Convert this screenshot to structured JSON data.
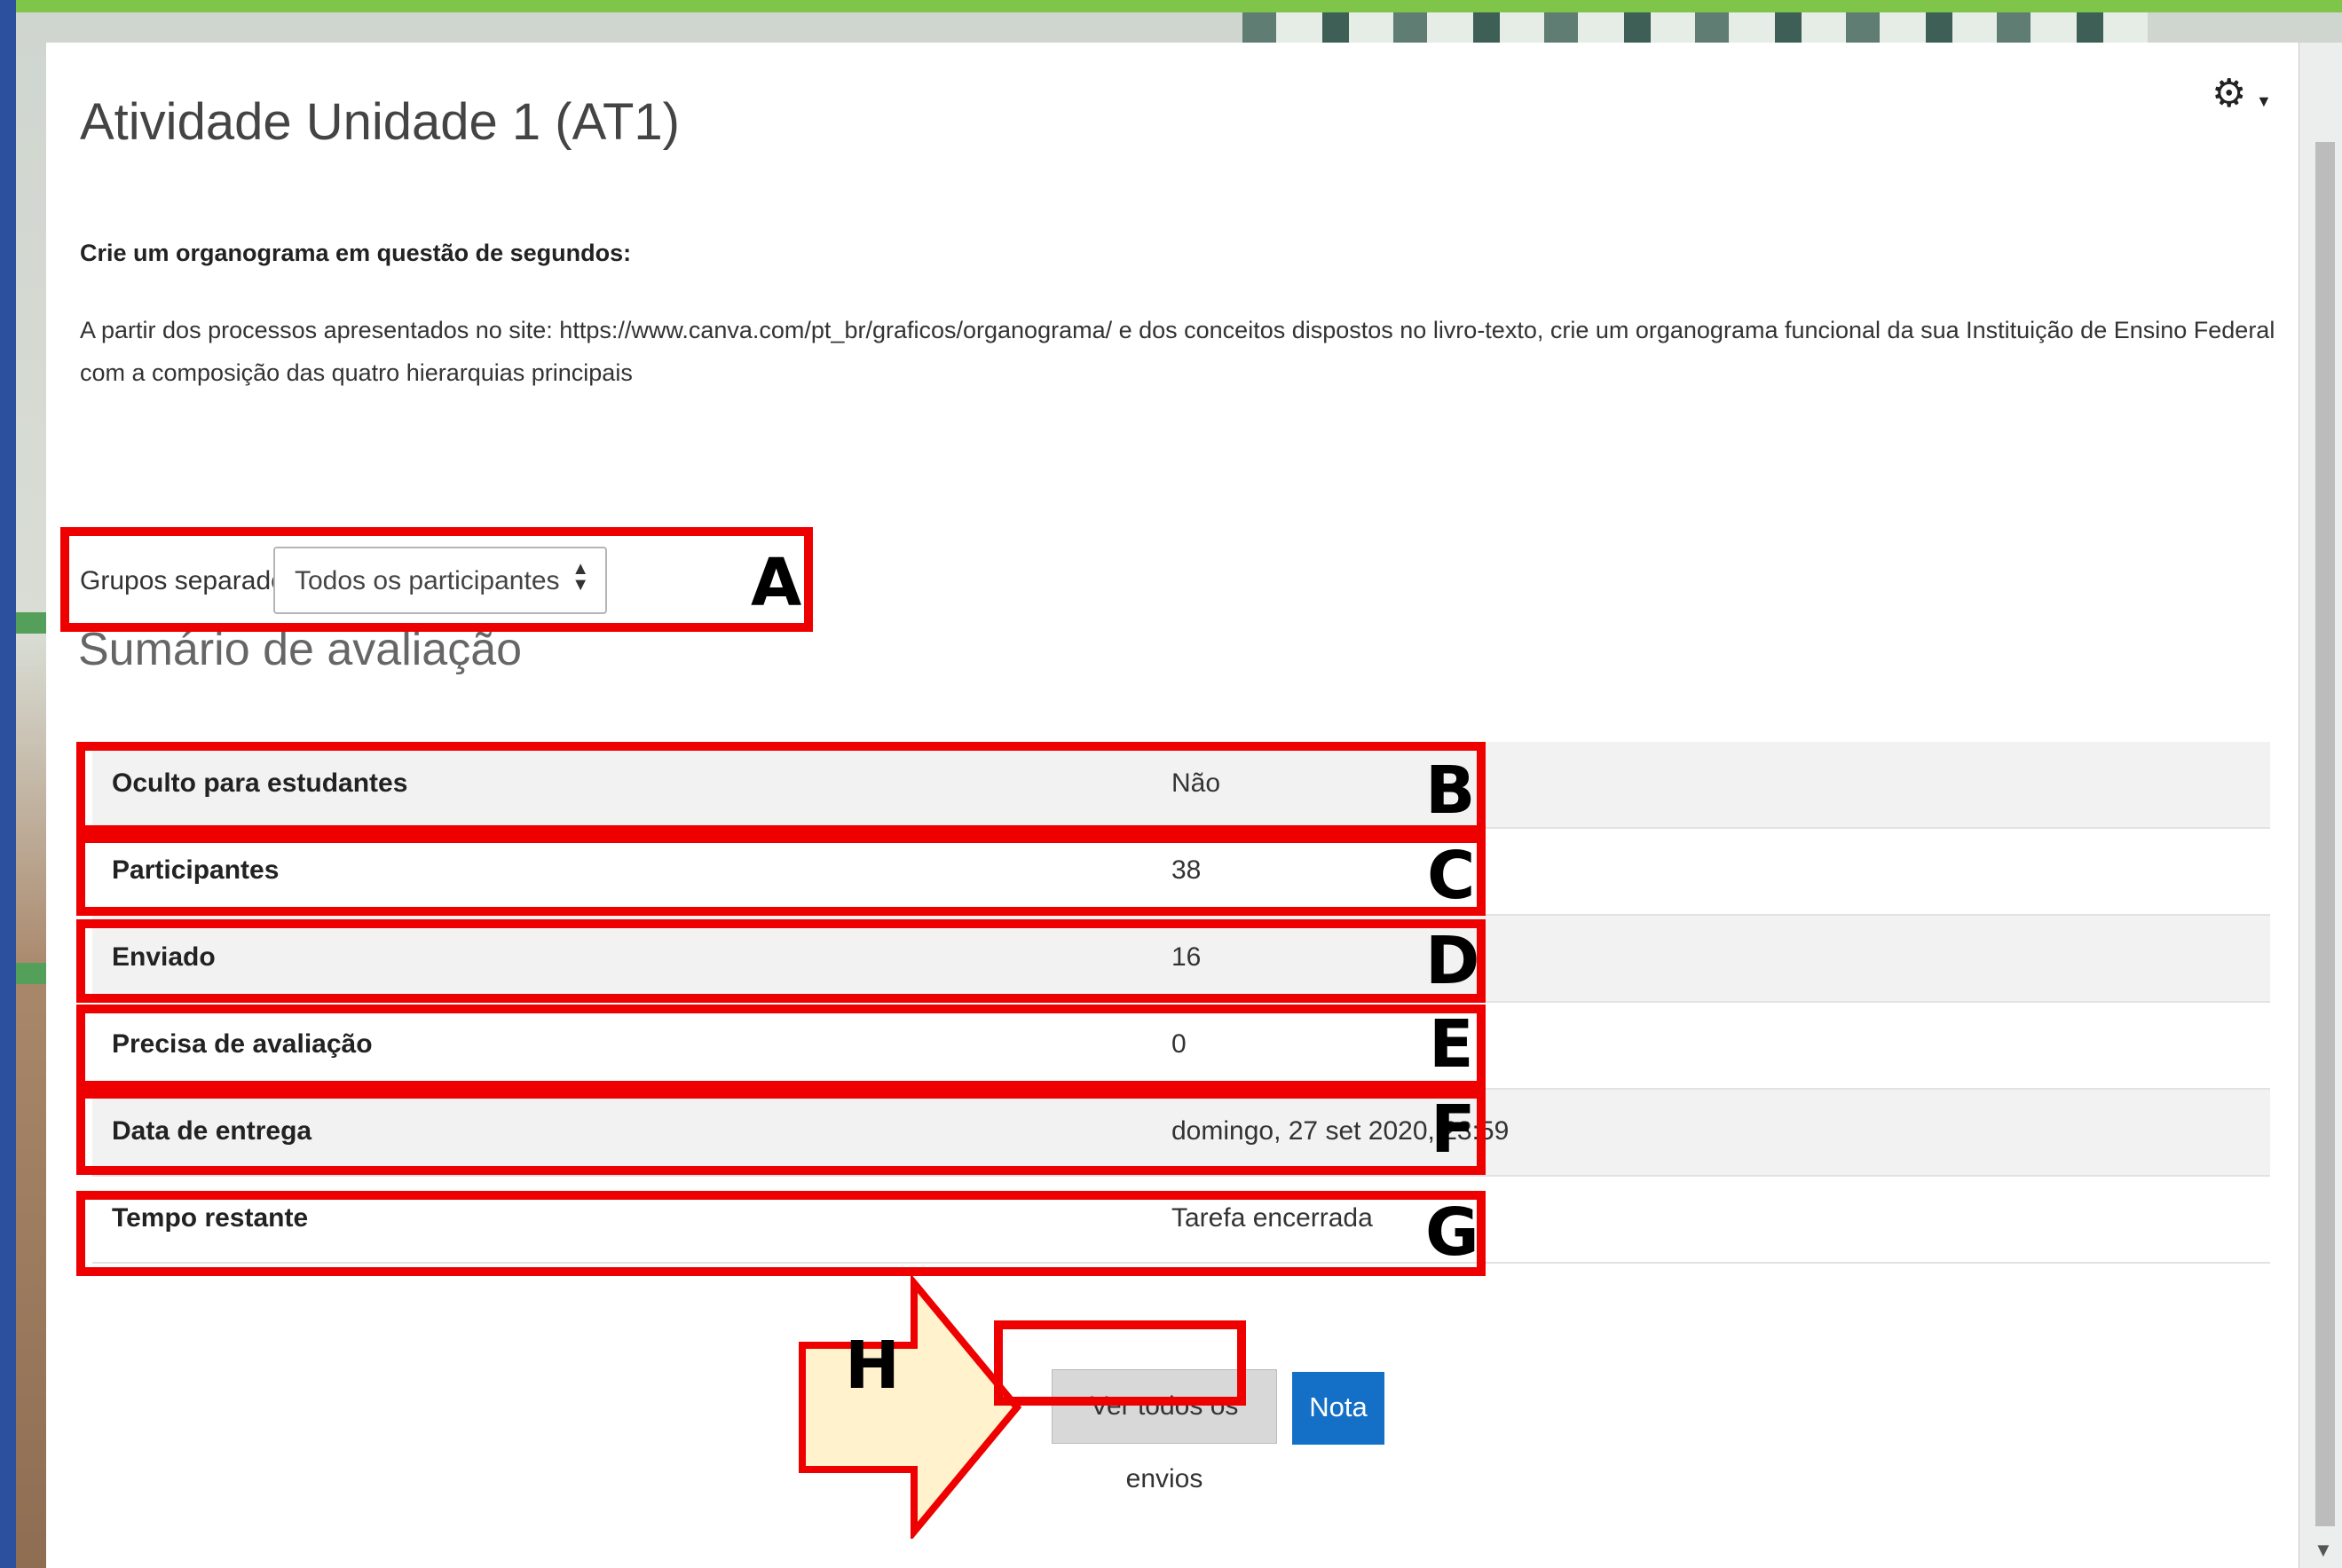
{
  "page": {
    "title": "Atividade Unidade 1 (AT1)",
    "intro_heading": "Crie um organograma em questão de segundos:",
    "intro_text": "A partir dos processos apresentados no site: https://www.canva.com/pt_br/graficos/organograma/ e dos conceitos dispostos no livro-texto, crie um organograma funcional da sua Instituição de Ensino Federal com a composição das quatro hierarquias principais"
  },
  "groups": {
    "label": "Grupos separados",
    "selected": "Todos os participantes"
  },
  "summary": {
    "heading": "Sumário de avaliação",
    "rows": [
      {
        "label": "Oculto para estudantes",
        "value": "Não"
      },
      {
        "label": "Participantes",
        "value": "38"
      },
      {
        "label": "Enviado",
        "value": "16"
      },
      {
        "label": "Precisa de avaliação",
        "value": "0"
      },
      {
        "label": "Data de entrega",
        "value": "domingo, 27 set 2020, 23:59"
      },
      {
        "label": "Tempo restante",
        "value": "Tarefa encerrada"
      }
    ]
  },
  "buttons": {
    "view_all": "Ver todos os envios",
    "grade": "Nota"
  },
  "annotations": {
    "a": "A",
    "b": "B",
    "c": "C",
    "d": "D",
    "e": "E",
    "f": "F",
    "g": "G",
    "h": "H"
  },
  "icons": {
    "settings": "gear-icon",
    "select": "select-arrows-icon"
  },
  "colors": {
    "annotation": "#ee0000",
    "grade_button": "#1470c6",
    "arrow_fill": "#fff2cc"
  }
}
